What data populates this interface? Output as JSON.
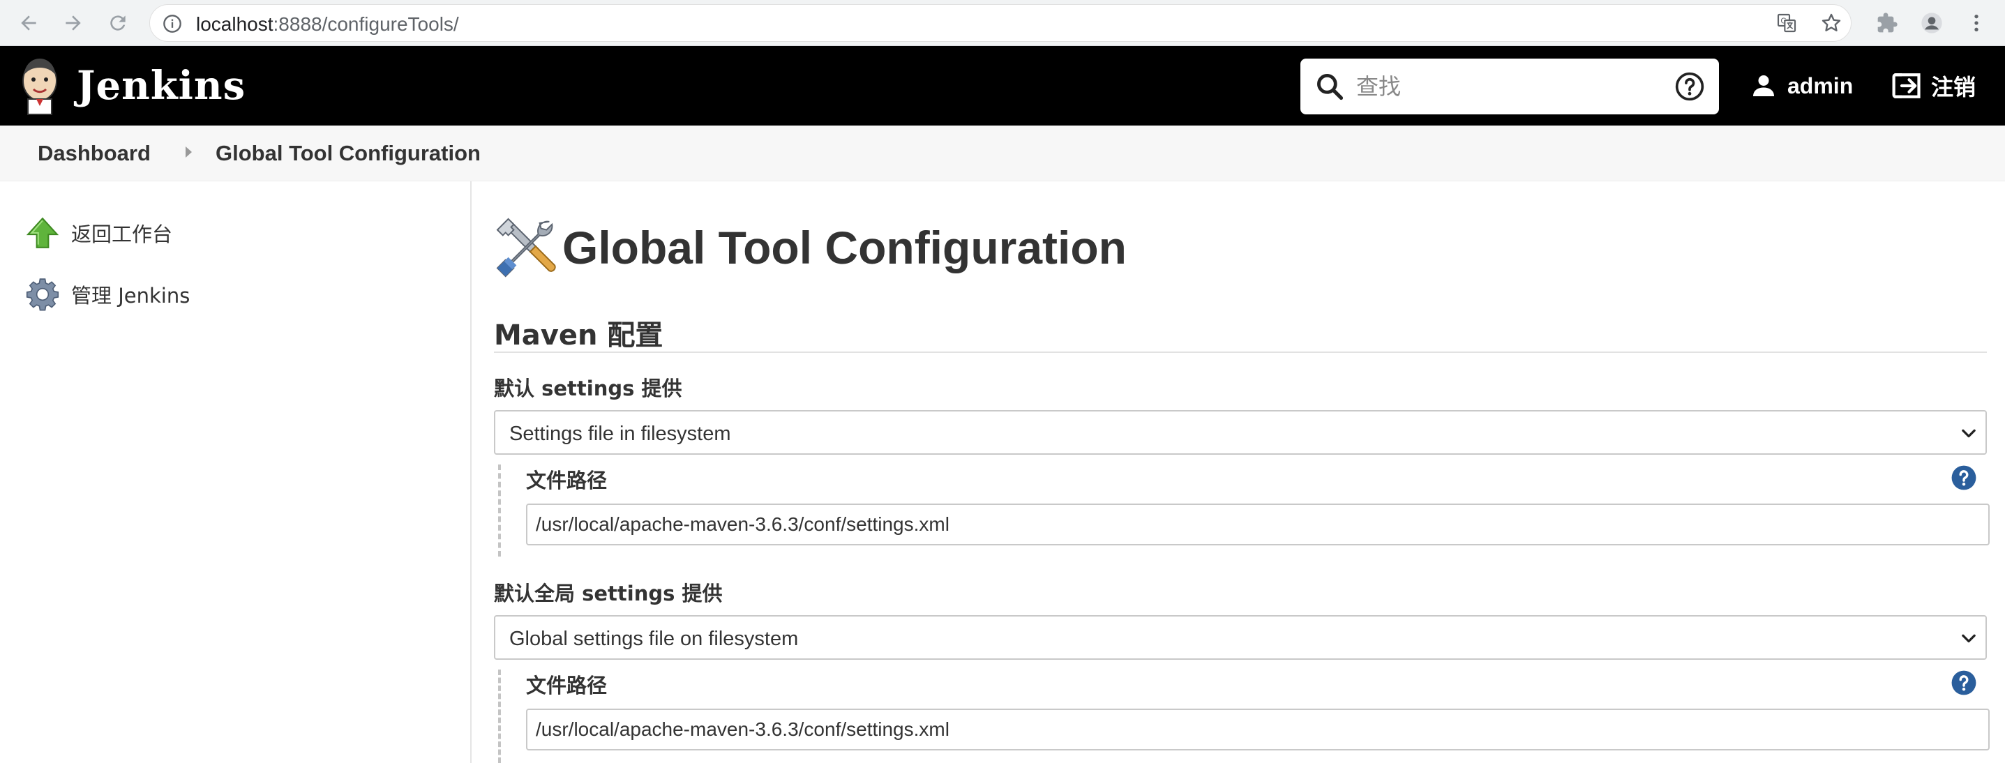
{
  "browser": {
    "url_host": "localhost",
    "url_path": ":8888/configureTools/"
  },
  "header": {
    "brand": "Jenkins",
    "search_placeholder": "查找",
    "user_name": "admin",
    "logout_label": "注销"
  },
  "breadcrumb": {
    "items": [
      "Dashboard",
      "Global Tool Configuration"
    ]
  },
  "sidebar": {
    "items": [
      {
        "label": "返回工作台",
        "icon": "up-arrow-icon"
      },
      {
        "label": "管理 Jenkins",
        "icon": "gear-icon"
      }
    ]
  },
  "main": {
    "title": "Global Tool Configuration",
    "section_title": "Maven 配置",
    "default_settings": {
      "label": "默认 settings 提供",
      "selected": "Settings file in filesystem",
      "path_label": "文件路径",
      "path_value": "/usr/local/apache-maven-3.6.3/conf/settings.xml"
    },
    "global_settings": {
      "label": "默认全局 settings 提供",
      "selected": "Global settings file on filesystem",
      "path_label": "文件路径",
      "path_value": "/usr/local/apache-maven-3.6.3/conf/settings.xml"
    }
  },
  "colors": {
    "header_bg": "#000000",
    "help_icon": "#2a5e9c",
    "up_arrow": "#5fb43c"
  }
}
